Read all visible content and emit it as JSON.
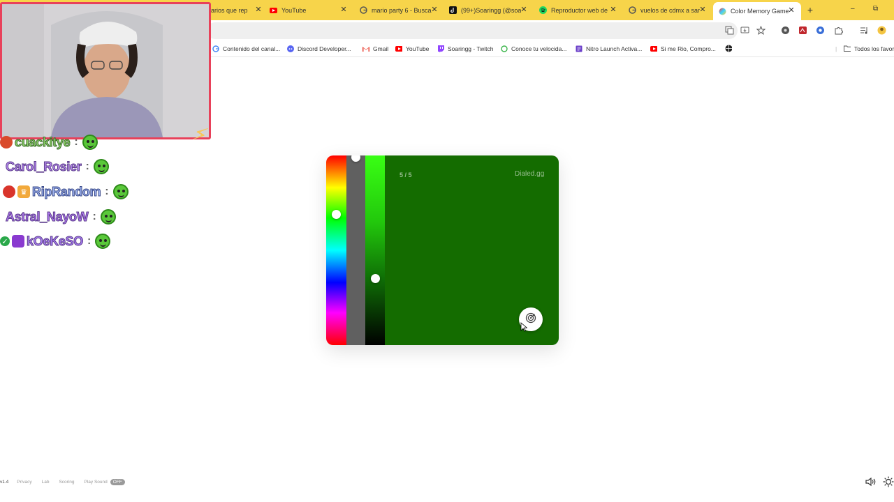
{
  "browser": {
    "tabs": [
      {
        "label": "arios que rep",
        "icon": "generic-page-icon",
        "active": false
      },
      {
        "label": "YouTube",
        "icon": "youtube-icon",
        "active": false
      },
      {
        "label": "mario party 6 - Busca",
        "icon": "google-icon",
        "active": false
      },
      {
        "label": "(99+)Soaringg (@soa",
        "icon": "tiktok-icon",
        "active": false
      },
      {
        "label": "Reproductor web de",
        "icon": "spotify-icon",
        "active": false
      },
      {
        "label": "vuelos de cdmx a sar",
        "icon": "google-icon",
        "active": false
      },
      {
        "label": "Color Memory Game",
        "icon": "color-wheel-icon",
        "active": true
      }
    ],
    "new_tab": "+",
    "close_glyph": "✕",
    "bookmarks": [
      {
        "label": "Contenido del canal...",
        "icon": "google-icon"
      },
      {
        "label": "Discord Developer...",
        "icon": "discord-icon"
      },
      {
        "label": "Gmail",
        "icon": "gmail-icon"
      },
      {
        "label": "YouTube",
        "icon": "youtube-icon"
      },
      {
        "label": "Soaringg - Twitch",
        "icon": "twitch-icon"
      },
      {
        "label": "Conoce tu velocida...",
        "icon": "speedtest-icon"
      },
      {
        "label": "Nitro Launch Activa...",
        "icon": "document-icon"
      },
      {
        "label": "Si me Rio, Compro...",
        "icon": "youtube-icon"
      },
      {
        "label": "Todos los favor",
        "icon": "folder-icon"
      }
    ]
  },
  "chat": [
    {
      "user": "cuackitye",
      "color": "#8ed36a",
      "badges": [
        "tomato-badge"
      ]
    },
    {
      "user": "Carol_Rosier",
      "color": "#b98cf0",
      "badges": []
    },
    {
      "user": "RipRandom",
      "color": "#9fb4f0",
      "badges": [
        "tomato-badge",
        "crown-badge"
      ]
    },
    {
      "user": "Astral_NayoW",
      "color": "#b07af0",
      "badges": []
    },
    {
      "user": "kOeKeSO",
      "color": "#a87ef2",
      "badges": [
        "check-badge",
        "cube-badge"
      ]
    }
  ],
  "game": {
    "round": "5 / 5",
    "brand": "Dialed.gg",
    "target_color": "#146c00",
    "hue_level": 0.31,
    "brightness_level": 0.65,
    "submit_icon": "target-icon"
  },
  "footer": {
    "version": "v1.4",
    "links": [
      "Privacy",
      "Lab",
      "Scoring",
      "Play Sound"
    ],
    "pill": "OFF"
  },
  "colors": {
    "tab_strip": "#f7d44a",
    "webcam_border": "#e8415a",
    "swatch": "#146c00"
  }
}
